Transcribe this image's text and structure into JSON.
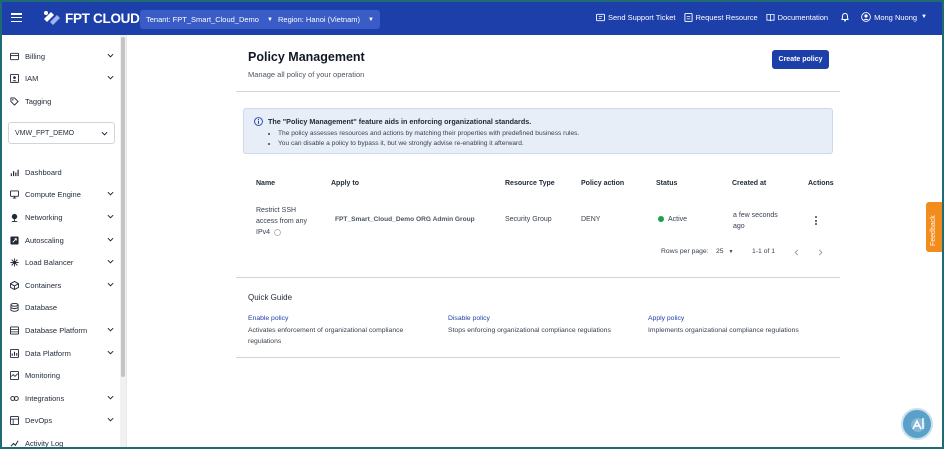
{
  "header": {
    "logo_text": "FPT CLOUD",
    "tenant": "Tenant: FPT_Smart_Cloud_Demo",
    "region": "Region: Hanoi (Vietnam)",
    "links": {
      "support": "Send Support Ticket",
      "request": "Request Resource",
      "docs": "Documentation"
    },
    "user": "Mong Nuong"
  },
  "sidebar": {
    "top_items": [
      {
        "label": "Billing",
        "icon": "billing-icon"
      },
      {
        "label": "IAM",
        "icon": "iam-icon"
      },
      {
        "label": "Tagging",
        "icon": "tag-icon"
      }
    ],
    "vpc_select": "VMW_FPT_DEMO",
    "items": [
      {
        "label": "Dashboard",
        "icon": "dashboard-icon"
      },
      {
        "label": "Compute Engine",
        "icon": "compute-icon"
      },
      {
        "label": "Networking",
        "icon": "network-icon"
      },
      {
        "label": "Autoscaling",
        "icon": "autoscaling-icon"
      },
      {
        "label": "Load Balancer",
        "icon": "load-balancer-icon"
      },
      {
        "label": "Containers",
        "icon": "container-icon"
      },
      {
        "label": "Database",
        "icon": "database-icon"
      },
      {
        "label": "Database Platform",
        "icon": "database-platform-icon"
      },
      {
        "label": "Data Platform",
        "icon": "data-platform-icon"
      },
      {
        "label": "Monitoring",
        "icon": "monitoring-icon"
      },
      {
        "label": "Integrations",
        "icon": "integrations-icon"
      },
      {
        "label": "DevOps",
        "icon": "devops-icon"
      },
      {
        "label": "Activity Log",
        "icon": "activity-log-icon"
      }
    ]
  },
  "page": {
    "title": "Policy Management",
    "subtitle": "Manage all policy of your operation",
    "create_button": "Create policy"
  },
  "info": {
    "title": "The \"Policy Management\" feature aids in enforcing organizational standards.",
    "bullet_1": "The policy assesses resources and actions by matching their properties with predefined business rules.",
    "bullet_2": "You can disable a policy to bypass it, but we strongly advise re-enabling it afterward."
  },
  "table": {
    "headers": {
      "name": "Name",
      "apply_to": "Apply to",
      "resource_type": "Resource Type",
      "policy_action": "Policy action",
      "status": "Status",
      "created_at": "Created at",
      "actions": "Actions"
    },
    "rows": [
      {
        "name": "Restrict SSH access from any IPv4",
        "apply_to": "FPT_Smart_Cloud_Demo ORG Admin Group",
        "resource_type": "Security Group",
        "policy_action": "DENY",
        "status": "Active",
        "created_at": "a few seconds ago"
      }
    ],
    "rows_per_page_label": "Rows per page:",
    "rows_per_page": "25",
    "range": "1-1 of 1"
  },
  "quick_guide": {
    "title": "Quick Guide",
    "items": [
      {
        "link": "Enable policy",
        "desc": "Activates enforcement of organizational compliance regulations"
      },
      {
        "link": "Disable policy",
        "desc": "Stops enforcing organizational compliance regulations"
      },
      {
        "link": "Apply policy",
        "desc": "Implements organizational compliance regulations"
      }
    ]
  },
  "feedback": "Feedback",
  "colors": {
    "brand": "#1c3faa",
    "active": "#16a34a",
    "feedback": "#f28c1c"
  }
}
